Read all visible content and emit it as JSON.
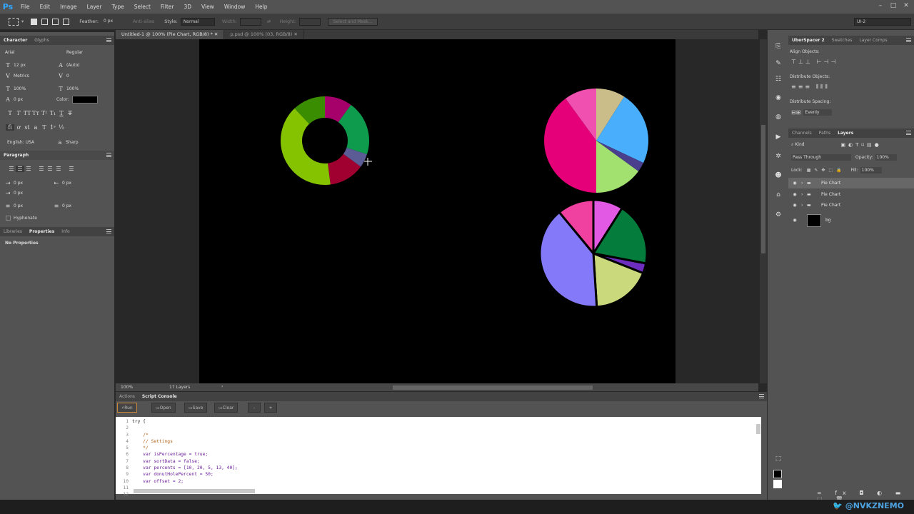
{
  "app": {
    "logo": "Ps"
  },
  "menu": [
    "File",
    "Edit",
    "Image",
    "Layer",
    "Type",
    "Select",
    "Filter",
    "3D",
    "View",
    "Window",
    "Help"
  ],
  "options": {
    "feather_label": "Feather:",
    "feather_value": "0 px",
    "antialias_label": "Anti-alias",
    "style_label": "Style:",
    "style_value": "Normal",
    "width_label": "Width:",
    "height_label": "Height:",
    "select_mask": "Select and Mask...",
    "workspace": "UI-2"
  },
  "character": {
    "tabs": [
      "Character",
      "Glyphs"
    ],
    "font": "Arial",
    "style": "Regular",
    "size": "12 px",
    "leading": "(Auto)",
    "kerning": "Metrics",
    "tracking": "0",
    "vscale": "100%",
    "hscale": "100%",
    "baseline": "0 px",
    "color_label": "Color:",
    "language": "English: USA",
    "antialias": "Sharp"
  },
  "paragraph": {
    "title": "Paragraph",
    "indent_left": "0 px",
    "indent_right": "0 px",
    "indent_first": "0 px",
    "space_before": "0 px",
    "space_after": "0 px",
    "hyphenate": "Hyphenate"
  },
  "properties": {
    "tabs": [
      "Libraries",
      "Properties",
      "Info"
    ],
    "empty": "No Properties"
  },
  "documents": {
    "tabs": [
      "Untitled-1 @ 100% (Pie Chart, RGB/8) *",
      "p.psd @ 100% (03, RGB/8)"
    ],
    "zoom": "100%",
    "layers_count": "17 Layers"
  },
  "console": {
    "tabs": [
      "Actions",
      "Script Console"
    ],
    "buttons": [
      "Run",
      "Open",
      "Save",
      "Clear",
      "–",
      "+"
    ],
    "lines": [
      {
        "n": "1",
        "t": "try {"
      },
      {
        "n": "2",
        "t": ""
      },
      {
        "n": "3",
        "t": "    /*"
      },
      {
        "n": "4",
        "t": "    // Settings"
      },
      {
        "n": "5",
        "t": "    */"
      },
      {
        "n": "6",
        "t": "    var isPercentage = true;"
      },
      {
        "n": "7",
        "t": "    var sortData = false;"
      },
      {
        "n": "8",
        "t": "    var percents = [10, 20, 5, 13, 40];"
      },
      {
        "n": "9",
        "t": "    var donutHolePercent = 50;"
      },
      {
        "n": "10",
        "t": "    var offset = 2;"
      },
      {
        "n": "11",
        "t": ""
      },
      {
        "n": "12",
        "t": ""
      }
    ]
  },
  "right": {
    "tabs1": [
      "UberSpacer 2",
      "Swatches",
      "Layer Comps"
    ],
    "align_title": "Align Objects:",
    "distribute_title": "Distribute Objects:",
    "spacing_title": "Distribute Spacing:",
    "spacing_value": "Evenly",
    "tabs2": [
      "Channels",
      "Paths",
      "Layers"
    ],
    "kind": "Kind",
    "blend": "Pass Through",
    "opacity_label": "Opacity:",
    "opacity": "100%",
    "lock_label": "Lock:",
    "fill_label": "Fill:",
    "fill": "100%",
    "layers": [
      "Pie Chart",
      "Pie Chart",
      "Pie Chart",
      "bg"
    ]
  },
  "charts": [
    {
      "name": "donut",
      "colors": [
        "#a6006a",
        "#0e9b4e",
        "#5b5b96",
        "#a00030",
        "#85c300",
        "#3a8c00"
      ],
      "values": [
        10,
        20,
        5,
        13,
        40,
        12
      ]
    },
    {
      "name": "pie1",
      "colors": [
        "#cbbd89",
        "#49aefb",
        "#4a3f8d",
        "#a2e070",
        "#e5007a",
        "#f050b0"
      ],
      "values": [
        9,
        23,
        3,
        15,
        40,
        10
      ]
    },
    {
      "name": "pie2",
      "colors": [
        "#e25ae4",
        "#047c3c",
        "#6d2ec0",
        "#c9d97c",
        "#8479f8",
        "#f040a0"
      ],
      "values": [
        9,
        19,
        3,
        18,
        40,
        11
      ]
    }
  ],
  "footer": {
    "handle": "@NVKZNEMO"
  }
}
